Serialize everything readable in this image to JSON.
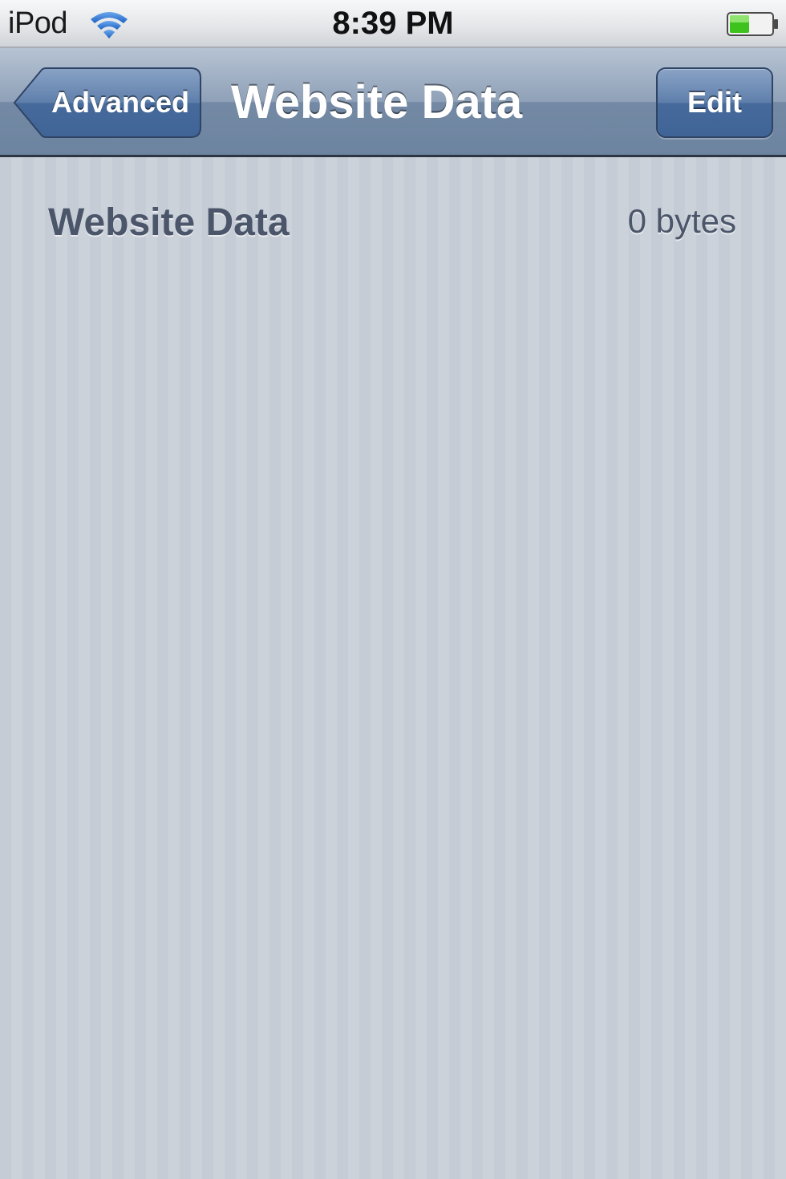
{
  "status_bar": {
    "carrier": "iPod",
    "time": "8:39 PM",
    "wifi_icon": "wifi-icon",
    "battery_icon": "battery-icon",
    "battery_color": "#3ec31e"
  },
  "nav_bar": {
    "back_label": "Advanced",
    "title": "Website Data",
    "edit_label": "Edit",
    "accent_color": "#466a9b"
  },
  "content": {
    "items": [
      {
        "label": "Website Data",
        "value": "0 bytes"
      }
    ]
  }
}
